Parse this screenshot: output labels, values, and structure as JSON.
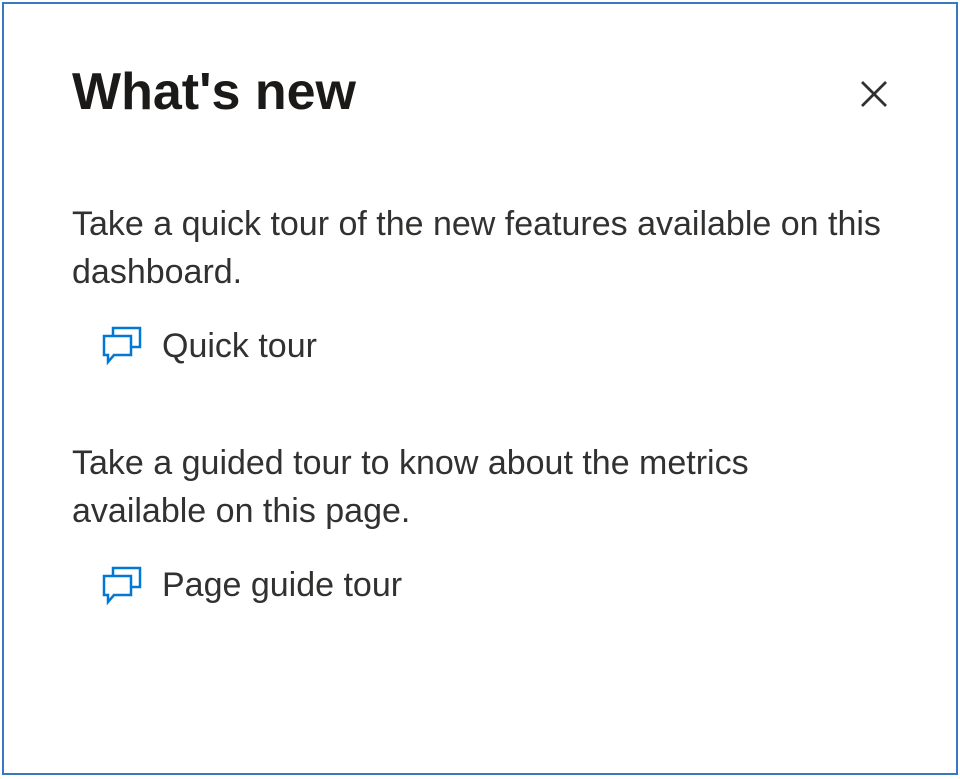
{
  "panel": {
    "title": "What's new",
    "sections": [
      {
        "description": "Take a quick tour of the new features available on this dashboard.",
        "link_label": "Quick tour"
      },
      {
        "description": "Take a guided tour to know about the metrics available on this page.",
        "link_label": "Page guide tour"
      }
    ]
  },
  "colors": {
    "border": "#3b76c2",
    "icon": "#0078d4",
    "text": "#323130",
    "title": "#1b1a19"
  }
}
